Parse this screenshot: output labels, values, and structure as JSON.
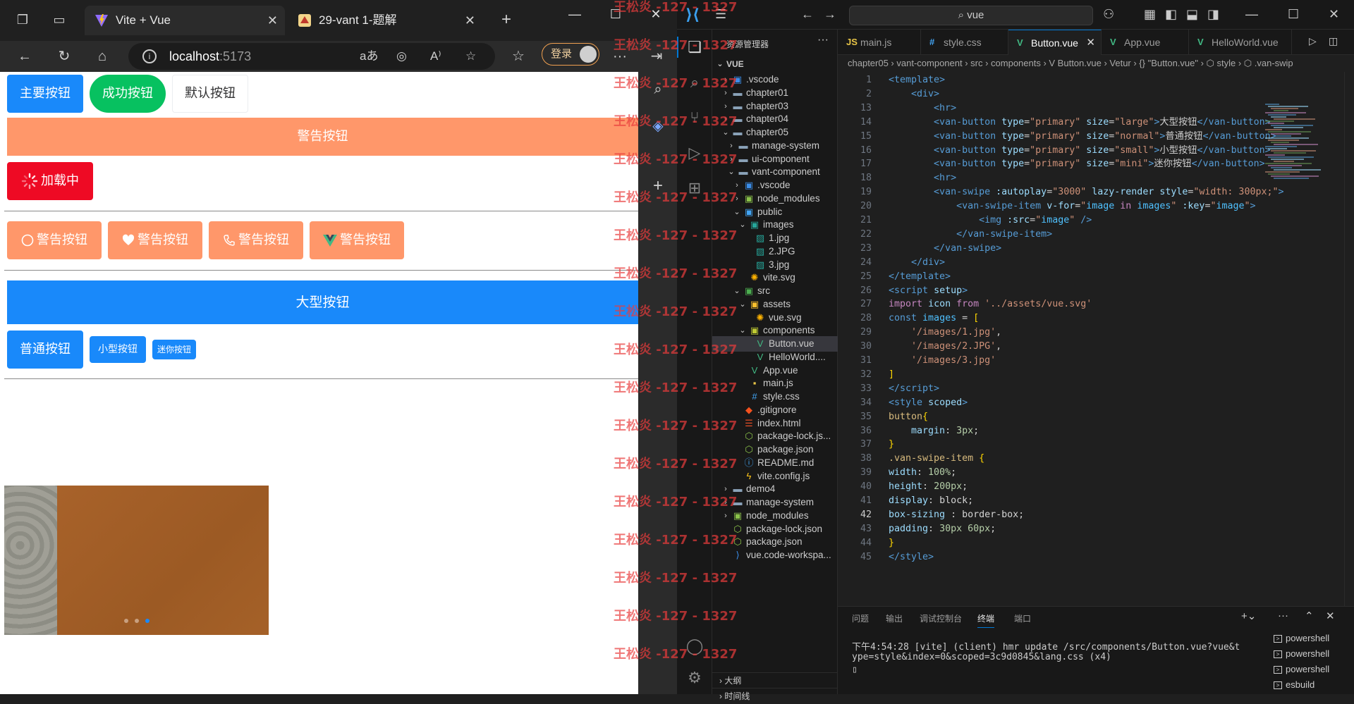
{
  "browser": {
    "tabs": [
      {
        "title": "Vite + Vue",
        "active": true
      },
      {
        "title": "29-vant 1-题解",
        "active": false
      }
    ],
    "address": {
      "host": "localhost",
      "port": ":5173"
    },
    "login_label": "登录",
    "page": {
      "row1": [
        {
          "label": "主要按钮",
          "type": "primary"
        },
        {
          "label": "成功按钮",
          "type": "success"
        },
        {
          "label": "默认按钮",
          "type": "default"
        }
      ],
      "block_warning": "警告按钮",
      "loading": "加载中",
      "icon_buttons": [
        {
          "label": "警告按钮",
          "icon": "circle-icon"
        },
        {
          "label": "警告按钮",
          "icon": "heart-icon"
        },
        {
          "label": "警告按钮",
          "icon": "phone-icon"
        },
        {
          "label": "警告按钮",
          "icon": "vue-logo-icon"
        }
      ],
      "large": "大型按钮",
      "normal": "普通按钮",
      "small": "小型按钮",
      "mini": "迷你按钮",
      "swipe": {
        "count": 3,
        "active_index": 2
      }
    }
  },
  "vscode": {
    "search": "vue",
    "explorer": {
      "header": "资源管理器",
      "root": "VUE",
      "items": [
        {
          "label": ".vscode",
          "depth": 1,
          "type": "vscode-folder-icon",
          "chev": "right"
        },
        {
          "label": "chapter01",
          "depth": 1,
          "type": "folder-icon",
          "chev": "right"
        },
        {
          "label": "chapter03",
          "depth": 1,
          "type": "folder-icon",
          "chev": "right"
        },
        {
          "label": "chapter04",
          "depth": 1,
          "type": "folder-icon",
          "chev": "right"
        },
        {
          "label": "chapter05",
          "depth": 1,
          "type": "folder-icon",
          "chev": "down"
        },
        {
          "label": "manage-system",
          "depth": 2,
          "type": "folder-icon",
          "chev": "right"
        },
        {
          "label": "ui-component",
          "depth": 2,
          "type": "folder-icon",
          "chev": "right"
        },
        {
          "label": "vant-component",
          "depth": 2,
          "type": "folder-icon",
          "chev": "down"
        },
        {
          "label": ".vscode",
          "depth": 3,
          "type": "vscode-folder-icon",
          "chev": "right"
        },
        {
          "label": "node_modules",
          "depth": 3,
          "type": "node-folder-icon",
          "chev": "right"
        },
        {
          "label": "public",
          "depth": 3,
          "type": "public-folder-icon",
          "chev": "down"
        },
        {
          "label": "images",
          "depth": 4,
          "type": "images-folder-icon",
          "chev": "down"
        },
        {
          "label": "1.jpg",
          "depth": 5,
          "type": "image-file-icon",
          "chev": ""
        },
        {
          "label": "2.JPG",
          "depth": 5,
          "type": "image-file-icon",
          "chev": ""
        },
        {
          "label": "3.jpg",
          "depth": 5,
          "type": "image-file-icon",
          "chev": ""
        },
        {
          "label": "vite.svg",
          "depth": 4,
          "type": "svg-file-icon",
          "chev": ""
        },
        {
          "label": "src",
          "depth": 3,
          "type": "src-folder-icon",
          "chev": "down"
        },
        {
          "label": "assets",
          "depth": 4,
          "type": "assets-folder-icon",
          "chev": "down"
        },
        {
          "label": "vue.svg",
          "depth": 5,
          "type": "svg-file-icon",
          "chev": ""
        },
        {
          "label": "components",
          "depth": 4,
          "type": "components-folder-icon",
          "chev": "down"
        },
        {
          "label": "Button.vue",
          "depth": 5,
          "type": "vue-file-icon",
          "chev": "",
          "selected": true
        },
        {
          "label": "HelloWorld....",
          "depth": 5,
          "type": "vue-file-icon",
          "chev": ""
        },
        {
          "label": "App.vue",
          "depth": 4,
          "type": "vue-file-icon",
          "chev": ""
        },
        {
          "label": "main.js",
          "depth": 4,
          "type": "js-file-icon",
          "chev": ""
        },
        {
          "label": "style.css",
          "depth": 4,
          "type": "css-file-icon",
          "chev": ""
        },
        {
          "label": ".gitignore",
          "depth": 3,
          "type": "git-file-icon",
          "chev": ""
        },
        {
          "label": "index.html",
          "depth": 3,
          "type": "html-file-icon",
          "chev": ""
        },
        {
          "label": "package-lock.js...",
          "depth": 3,
          "type": "json-file-icon",
          "chev": ""
        },
        {
          "label": "package.json",
          "depth": 3,
          "type": "json-file-icon",
          "chev": ""
        },
        {
          "label": "README.md",
          "depth": 3,
          "type": "info-file-icon",
          "chev": ""
        },
        {
          "label": "vite.config.js",
          "depth": 3,
          "type": "vite-file-icon",
          "chev": ""
        },
        {
          "label": "demo4",
          "depth": 1,
          "type": "folder-icon",
          "chev": "right"
        },
        {
          "label": "manage-system",
          "depth": 1,
          "type": "folder-icon",
          "chev": "right"
        },
        {
          "label": "node_modules",
          "depth": 1,
          "type": "node-folder-icon",
          "chev": "right"
        },
        {
          "label": "package-lock.json",
          "depth": 1,
          "type": "json-file-icon",
          "chev": ""
        },
        {
          "label": "package.json",
          "depth": 1,
          "type": "json-file-icon",
          "chev": ""
        },
        {
          "label": "vue.code-workspa...",
          "depth": 1,
          "type": "vscode-file-icon",
          "chev": ""
        }
      ],
      "outline": "大纲",
      "timeline": "时间线"
    },
    "tabs": [
      {
        "label": "main.js",
        "icon": "JS",
        "color": "#e8c547"
      },
      {
        "label": "style.css",
        "icon": "#",
        "color": "#42a5f5"
      },
      {
        "label": "Button.vue",
        "icon": "V",
        "color": "#41b883",
        "active": true
      },
      {
        "label": "App.vue",
        "icon": "V",
        "color": "#41b883"
      },
      {
        "label": "HelloWorld.vue",
        "icon": "V",
        "color": "#41b883"
      }
    ],
    "breadcrumb": "chapter05 › vant-component › src › components › V Button.vue › Vetur › {} \"Button.vue\" › ⬡ style › ⬡ .van-swip",
    "code": [
      {
        "n": "1",
        "html": "<span class='t-tag'>&lt;template&gt;</span>"
      },
      {
        "n": "2",
        "html": "    <span class='t-tag'>&lt;div&gt;</span>"
      },
      {
        "n": "13",
        "html": "        <span class='t-tag'>&lt;hr&gt;</span>"
      },
      {
        "n": "14",
        "html": "        <span class='t-tag'>&lt;van-button</span> <span class='t-attr'>type</span>=<span class='t-str'>\"primary\"</span> <span class='t-attr'>size</span>=<span class='t-str'>\"large\"</span><span class='t-tag'>&gt;</span>大型按钮<span class='t-tag'>&lt;/van-button&gt;</span>"
      },
      {
        "n": "15",
        "html": "        <span class='t-tag'>&lt;van-button</span> <span class='t-attr'>type</span>=<span class='t-str'>\"primary\"</span> <span class='t-attr'>size</span>=<span class='t-str'>\"normal\"</span><span class='t-tag'>&gt;</span>普通按钮<span class='t-tag'>&lt;/van-button&gt;</span>"
      },
      {
        "n": "16",
        "html": "        <span class='t-tag'>&lt;van-button</span> <span class='t-attr'>type</span>=<span class='t-str'>\"primary\"</span> <span class='t-attr'>size</span>=<span class='t-str'>\"small\"</span><span class='t-tag'>&gt;</span>小型按钮<span class='t-tag'>&lt;/van-button&gt;</span>"
      },
      {
        "n": "17",
        "html": "        <span class='t-tag'>&lt;van-button</span> <span class='t-attr'>type</span>=<span class='t-str'>\"primary\"</span> <span class='t-attr'>size</span>=<span class='t-str'>\"mini\"</span><span class='t-tag'>&gt;</span>迷你按钮<span class='t-tag'>&lt;/van-button&gt;</span>"
      },
      {
        "n": "18",
        "html": "        <span class='t-tag'>&lt;hr&gt;</span>"
      },
      {
        "n": "19",
        "html": "        <span class='t-tag'>&lt;van-swipe</span> <span class='t-attr'>:autoplay</span>=<span class='t-str'>\"3000\"</span> <span class='t-attr'>lazy-render</span> <span class='t-attr'>style</span>=<span class='t-str'>\"width: 300px;\"</span><span class='t-tag'>&gt;</span>"
      },
      {
        "n": "20",
        "html": "            <span class='t-tag'>&lt;van-swipe-item</span> <span class='t-attr'>v-for</span>=<span class='t-str'>\"</span><span class='t-var'>image</span> <span class='t-kw'>in</span> <span class='t-var'>images</span><span class='t-str'>\"</span> <span class='t-attr'>:key</span>=<span class='t-str'>\"</span><span class='t-var'>image</span><span class='t-str'>\"</span><span class='t-tag'>&gt;</span>"
      },
      {
        "n": "21",
        "html": "                <span class='t-tag'>&lt;img</span> <span class='t-attr'>:src</span>=<span class='t-str'>\"</span><span class='t-var'>image</span><span class='t-str'>\"</span> <span class='t-tag'>/&gt;</span>"
      },
      {
        "n": "22",
        "html": "            <span class='t-tag'>&lt;/van-swipe-item&gt;</span>"
      },
      {
        "n": "23",
        "html": "        <span class='t-tag'>&lt;/van-swipe&gt;</span>"
      },
      {
        "n": "24",
        "html": "    <span class='t-tag'>&lt;/div&gt;</span>"
      },
      {
        "n": "25",
        "html": "<span class='t-tag'>&lt;/template&gt;</span>"
      },
      {
        "n": "26",
        "html": "<span class='t-tag'>&lt;script</span> <span class='t-attr'>setup</span><span class='t-tag'>&gt;</span>"
      },
      {
        "n": "27",
        "html": "<span class='t-kw'>import</span> <span class='t-prop'>icon</span> <span class='t-kw'>from</span> <span class='t-str'>'../assets/vue.svg'</span>"
      },
      {
        "n": "28",
        "html": "<span class='t-key'>const</span> <span class='t-var'>images</span> = <span class='t-br'>[</span>"
      },
      {
        "n": "29",
        "html": "    <span class='t-str'>'/images/1.jpg'</span>,"
      },
      {
        "n": "30",
        "html": "    <span class='t-str'>'/images/2.JPG'</span>,"
      },
      {
        "n": "31",
        "html": "    <span class='t-str'>'/images/3.jpg'</span>"
      },
      {
        "n": "32",
        "html": "<span class='t-br'>]</span>"
      },
      {
        "n": "33",
        "html": "<span class='t-tag'>&lt;/script&gt;</span>"
      },
      {
        "n": "34",
        "html": "<span class='t-tag'>&lt;style</span> <span class='t-attr'>scoped</span><span class='t-tag'>&gt;</span>"
      },
      {
        "n": "35",
        "html": "<span class='t-sel'>button</span><span class='t-br'>{</span>"
      },
      {
        "n": "36",
        "html": "    <span class='t-prop'>margin</span>: <span class='t-num'>3px</span>;"
      },
      {
        "n": "37",
        "html": "<span class='t-br'>}</span>"
      },
      {
        "n": "38",
        "html": "<span class='t-sel'>.van-swipe-item</span> <span class='t-br'>{</span>"
      },
      {
        "n": "39",
        "html": "<span class='t-prop'>width</span>: <span class='t-num'>100%</span>;"
      },
      {
        "n": "40",
        "html": "<span class='t-prop'>height</span>: <span class='t-num'>200px</span>;"
      },
      {
        "n": "41",
        "html": "<span class='t-prop'>display</span>: <span class='t-tx'>block</span>;"
      },
      {
        "n": "42",
        "html": "<span class='t-prop'>box-sizing</span> : <span class='t-tx'>border-box</span>;",
        "current": true
      },
      {
        "n": "43",
        "html": "<span class='t-prop'>padding</span>: <span class='t-num'>30px 60px</span>;"
      },
      {
        "n": "44",
        "html": "<span class='t-br'>}</span>"
      },
      {
        "n": "45",
        "html": "<span class='t-tag'>&lt;/style&gt;</span>"
      }
    ],
    "panel": {
      "tabs": [
        "问题",
        "输出",
        "调试控制台",
        "终端",
        "端口"
      ],
      "active": "终端",
      "terminal_line1": "下午4:54:28 [vite] (client) hmr update /src/components/Button.vue?vue&t",
      "terminal_line2": "ype=style&index=0&scoped=3c9d0845&lang.css (x4)",
      "shells": [
        "powershell",
        "powershell",
        "powershell",
        "esbuild"
      ]
    }
  },
  "watermark": "王松炎 -127 - 1327",
  "colors": {
    "primary": "#1989fa",
    "success": "#07c160",
    "warning": "#ff976a",
    "danger": "#ee0a24"
  }
}
